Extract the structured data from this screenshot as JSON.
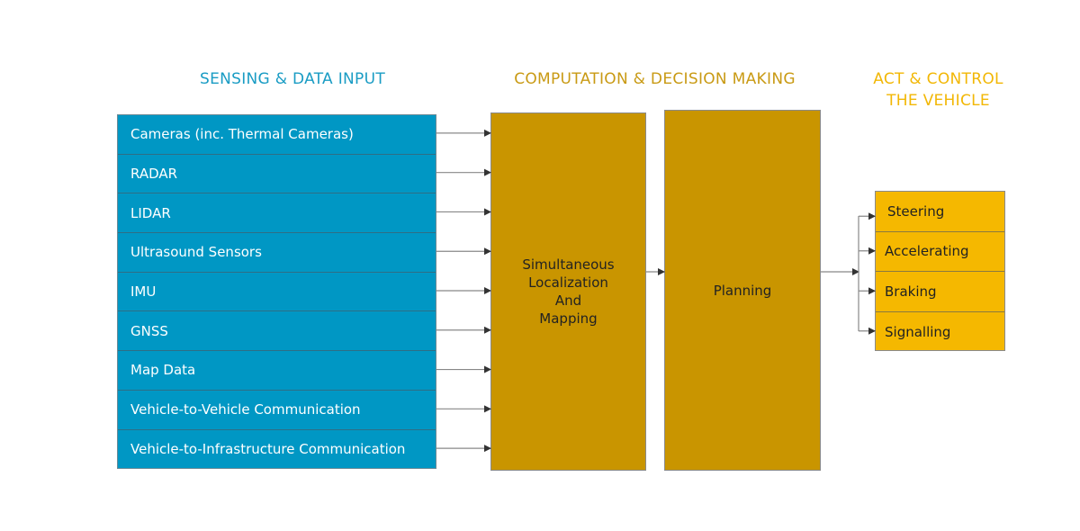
{
  "headers": {
    "sensing": "SENSING & DATA INPUT",
    "computation": "COMPUTATION & DECISION MAKING",
    "act_line1": "ACT & CONTROL",
    "act_line2": "THE VEHICLE"
  },
  "sensing_inputs": [
    "Cameras (inc. Thermal Cameras)",
    "RADAR",
    "LIDAR",
    "Ultrasound Sensors",
    "IMU",
    "GNSS",
    "Map Data",
    "Vehicle-to-Vehicle Communication",
    "Vehicle-to-Infrastructure Communication"
  ],
  "computation_blocks": {
    "slam": [
      "Simultaneous",
      "Localization",
      "And",
      "Mapping"
    ],
    "planning": "Planning"
  },
  "actions": [
    "Steering",
    "Accelerating",
    "Braking",
    "Signalling"
  ],
  "colors": {
    "sensing_blue": "#0097c4",
    "computation_gold": "#c99500",
    "action_yellow": "#f5b800"
  }
}
